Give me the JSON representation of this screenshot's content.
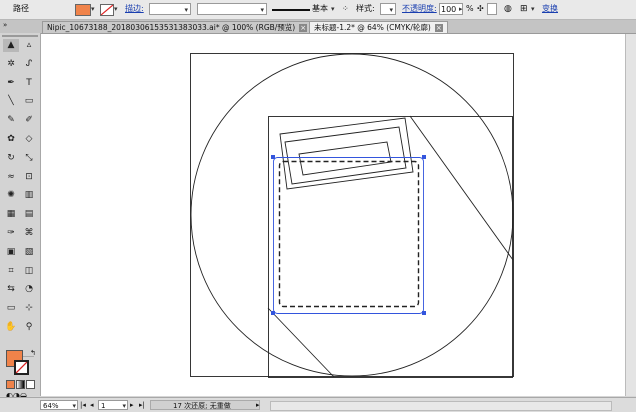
{
  "control_bar": {
    "object_type": "路径",
    "stroke_label": "描边:",
    "stroke_width_value": "",
    "brush_value": "",
    "line_style": "基本",
    "style_label": "样式:",
    "opacity_label": "不透明度:",
    "opacity_value": "100",
    "opacity_unit": "%",
    "transform_label": "变换",
    "fill_color": "#f0834a"
  },
  "tabs": [
    {
      "label": "Nipic_10673188_20180306153531383033.ai* @ 100% (RGB/预览)",
      "active": false
    },
    {
      "label": "未标题-1.2* @ 64% (CMYK/轮廓)",
      "active": true
    }
  ],
  "toolbox": {
    "fill_color": "#f0834a",
    "stroke_color": "#ffffff",
    "tools": [
      "selection-tool",
      "direct-selection-tool",
      "magic-wand-tool",
      "lasso-tool",
      "pen-tool",
      "type-tool",
      "line-tool",
      "rectangle-tool",
      "paintbrush-tool",
      "pencil-tool",
      "blob-brush-tool",
      "eraser-tool",
      "rotate-tool",
      "scale-tool",
      "warp-tool",
      "free-transform-tool",
      "symbol-sprayer-tool",
      "column-graph-tool",
      "mesh-tool",
      "gradient-tool",
      "eyedropper-tool",
      "blend-tool",
      "live-paint-tool",
      "live-paint-selection-tool",
      "crop-tool",
      "slice-tool",
      "width-tool",
      "shape-builder-tool",
      "artboard-tool",
      "perspective-grid-tool",
      "hand-tool",
      "zoom-tool"
    ]
  },
  "status_bar": {
    "zoom": "64%",
    "page": "1",
    "message": "17 次还原; 无重做"
  }
}
